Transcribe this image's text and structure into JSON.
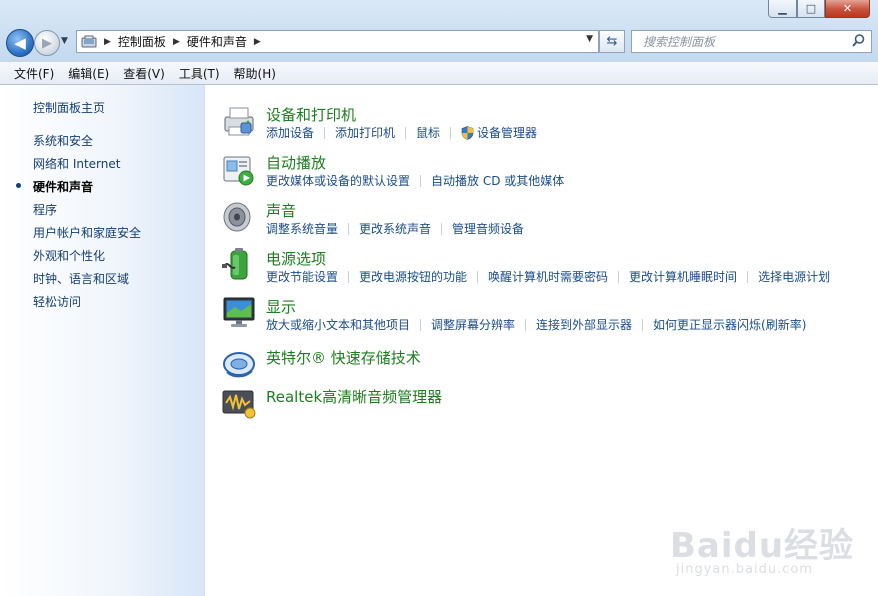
{
  "window": {
    "minimize": "▁",
    "maximize": "□",
    "close": "✕"
  },
  "address": {
    "crumbs": [
      "控制面板",
      "硬件和声音"
    ]
  },
  "search": {
    "placeholder": "搜索控制面板"
  },
  "menu": [
    "文件(F)",
    "编辑(E)",
    "查看(V)",
    "工具(T)",
    "帮助(H)"
  ],
  "sidebar": {
    "home": "控制面板主页",
    "items": [
      {
        "label": "系统和安全"
      },
      {
        "label": "网络和 Internet"
      },
      {
        "label": "硬件和声音",
        "current": true
      },
      {
        "label": "程序"
      },
      {
        "label": "用户帐户和家庭安全"
      },
      {
        "label": "外观和个性化"
      },
      {
        "label": "时钟、语言和区域"
      },
      {
        "label": "轻松访问"
      }
    ]
  },
  "categories": [
    {
      "title": "设备和打印机",
      "icon": "printer-icon",
      "links": [
        "添加设备",
        "添加打印机",
        "鼠标",
        "设备管理器"
      ]
    },
    {
      "title": "自动播放",
      "icon": "autoplay-icon",
      "links": [
        "更改媒体或设备的默认设置",
        "自动播放 CD 或其他媒体"
      ]
    },
    {
      "title": "声音",
      "icon": "speaker-icon",
      "links": [
        "调整系统音量",
        "更改系统声音",
        "管理音频设备"
      ]
    },
    {
      "title": "电源选项",
      "icon": "battery-icon",
      "links": [
        "更改节能设置",
        "更改电源按钮的功能",
        "唤醒计算机时需要密码",
        "更改计算机睡眠时间",
        "选择电源计划"
      ]
    },
    {
      "title": "显示",
      "icon": "monitor-icon",
      "links": [
        "放大或缩小文本和其他项目",
        "调整屏幕分辨率",
        "连接到外部显示器",
        "如何更正显示器闪烁(刷新率)"
      ]
    },
    {
      "title": "英特尔® 快速存储技术",
      "icon": "intel-storage-icon",
      "links": []
    },
    {
      "title": "Realtek高清晰音频管理器",
      "icon": "realtek-audio-icon",
      "links": []
    }
  ],
  "watermark": {
    "brand": "Baidu经验",
    "url": "jingyan.baidu.com"
  }
}
